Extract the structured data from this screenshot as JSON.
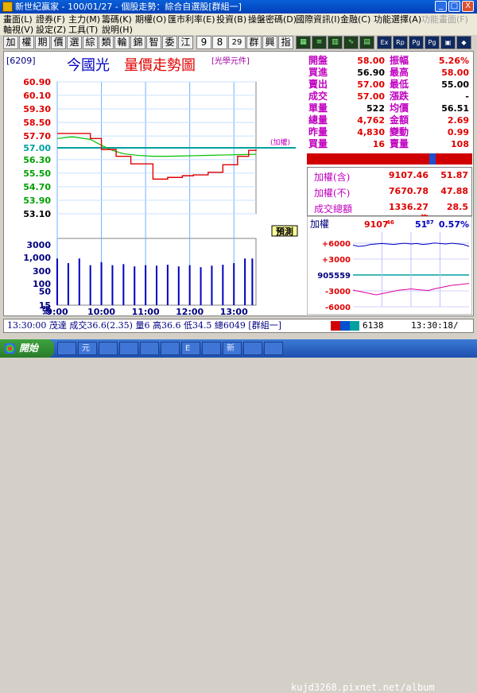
{
  "window": {
    "title": "新世紀贏家 - 100/01/27 - 個股走勢：綜合自選股[群組一]",
    "minimize_label": "_",
    "restore_label": "□",
    "close_label": "X"
  },
  "menu": {
    "row1": [
      {
        "label": "畫面(L)",
        "disabled": false
      },
      {
        "label": "證券(F)",
        "disabled": false
      },
      {
        "label": "主力(M)",
        "disabled": false
      },
      {
        "label": "籌碼(K)",
        "disabled": false
      },
      {
        "label": "期權(O)",
        "disabled": false
      },
      {
        "label": "匯市利率(E)",
        "disabled": false
      },
      {
        "label": "投資(B)",
        "disabled": false
      },
      {
        "label": "操盤密碼(D)",
        "disabled": false
      },
      {
        "label": "國際資訊(I)",
        "disabled": false
      },
      {
        "label": "金融(C)",
        "disabled": false
      },
      {
        "label": "功能選擇(A)",
        "disabled": false
      },
      {
        "label": "功能畫面(F)",
        "disabled": true
      }
    ],
    "row2": [
      {
        "label": "軸視(V)",
        "disabled": false
      },
      {
        "label": "設定(Z)",
        "disabled": false
      },
      {
        "label": "工具(T)",
        "disabled": false
      },
      {
        "label": "說明(H)",
        "disabled": false
      }
    ]
  },
  "toolbar": {
    "buttons": [
      "加",
      "權",
      "期",
      "價",
      "選",
      "綜",
      "類",
      "輪",
      "錦",
      "智",
      "委",
      "江",
      "9",
      "8",
      "29",
      "群",
      "興",
      "指"
    ],
    "icon_buttons": [
      "green-grid",
      "green-lines",
      "green-bars",
      "green-wave",
      "green-doc",
      "Ex",
      "Rp",
      "Page",
      "Page",
      "blue-box",
      "blue-arrow"
    ]
  },
  "stock": {
    "code": "[6209]",
    "name": "今國光",
    "chart_title": "量價走勢圖",
    "unit": "[光學元件]",
    "ref_tag": "(加權)",
    "forecast_tag": "預測"
  },
  "colors": {
    "price_line": "#e00000",
    "avg_line": "#00c000",
    "volume_bar": "#0000c0",
    "ref_line": "#00a0a0",
    "label_purple": "#c000c0",
    "up": "#e00000",
    "down": "#00a000"
  },
  "chart_data": {
    "type": "line",
    "title": "量價走勢圖",
    "y_ticks": [
      "60.90",
      "60.10",
      "59.30",
      "58.50",
      "57.70",
      "57.00",
      "56.30",
      "55.50",
      "54.70",
      "53.90",
      "53.10"
    ],
    "y_tick_colors": [
      "up",
      "up",
      "up",
      "up",
      "up",
      "ref",
      "down",
      "down",
      "down",
      "down",
      "plain"
    ],
    "ylim": [
      53.1,
      60.9
    ],
    "ref_price": 57.0,
    "vol_ticks": [
      "3000",
      "1,000",
      "300",
      "100",
      "50",
      "15",
      "張"
    ],
    "x_ticks": [
      "9:00",
      "10:00",
      "11:00",
      "12:00",
      "13:00"
    ],
    "x_range": [
      0,
      270
    ],
    "price_series": {
      "name": "",
      "x": [
        0,
        25,
        45,
        60,
        80,
        100,
        130,
        150,
        170,
        185,
        205,
        225,
        245,
        260,
        270
      ],
      "y": [
        57.85,
        57.85,
        57.55,
        56.9,
        56.5,
        56.05,
        55.15,
        55.25,
        55.35,
        55.4,
        55.55,
        56.0,
        56.5,
        56.85,
        56.9
      ]
    },
    "avg_series": {
      "name": "",
      "x": [
        0,
        20,
        45,
        60,
        75,
        90,
        110,
        130,
        150,
        170,
        190,
        210,
        230,
        250,
        270
      ],
      "y": [
        57.55,
        57.65,
        57.5,
        57.15,
        56.85,
        56.65,
        56.55,
        56.5,
        56.5,
        56.52,
        56.54,
        56.56,
        56.58,
        56.6,
        56.62
      ]
    },
    "volume": {
      "x": [
        0,
        15,
        30,
        45,
        60,
        75,
        90,
        105,
        120,
        135,
        150,
        165,
        180,
        195,
        210,
        225,
        240,
        255,
        265
      ],
      "values": [
        900,
        600,
        900,
        500,
        650,
        500,
        550,
        450,
        500,
        480,
        520,
        450,
        500,
        420,
        480,
        520,
        600,
        900,
        900
      ]
    }
  },
  "quotes": [
    {
      "l1": "開盤",
      "v1": "58.00",
      "c1": "up",
      "l2": "振幅",
      "v2": "5.26%",
      "c2": "up"
    },
    {
      "l1": "買進",
      "v1": "56.90",
      "c1": "plain",
      "l2": "最高",
      "v2": "58.00",
      "c2": "up"
    },
    {
      "l1": "賣出",
      "v1": "57.00",
      "c1": "up",
      "l2": "最低",
      "v2": "55.00",
      "c2": "plain"
    },
    {
      "l1": "成交",
      "v1": "57.00",
      "c1": "up",
      "l2": "漲跌",
      "v2": "-",
      "c2": "plain"
    },
    {
      "l1": "單量",
      "v1": "522",
      "c1": "plain",
      "l2": "均價",
      "v2": "56.51",
      "c2": "plain"
    },
    {
      "l1": "總量",
      "v1": "4,762",
      "c1": "up",
      "l2": "金額",
      "v2": "2.69",
      "c2": "up"
    },
    {
      "l1": "昨量",
      "v1": "4,830",
      "c1": "up",
      "l2": "變動",
      "v2": "0.99",
      "c2": "up"
    },
    {
      "l1": "買量",
      "v1": "16",
      "c1": "up",
      "l2": "賣量",
      "v2": "108",
      "c2": "up"
    }
  ],
  "index_box": [
    {
      "label": "加權(含)",
      "value": "9107.46",
      "extra": "51.87"
    },
    {
      "label": "加權(不)",
      "value": "7670.78",
      "extra": "47.88"
    },
    {
      "label": "成交總額",
      "value": "1336.27億",
      "extra": "28.5"
    }
  ],
  "mini_chart": {
    "label": "加權",
    "value": "9107",
    "value_sup": "46",
    "change": "51",
    "change_sup": "87",
    "pct": "0.57%",
    "y_ticks": [
      "+6000",
      "+3000",
      "905559",
      "-3000",
      "-6000"
    ],
    "index_line": [
      0.55,
      0.6,
      0.58,
      0.52,
      0.5,
      0.48,
      0.5,
      0.52,
      0.49,
      0.47,
      0.5,
      0.48,
      0.52,
      0.5,
      0.46,
      0.48,
      0.5,
      0.47,
      0.49,
      0.52,
      0.6
    ],
    "lower_line": [
      0.5,
      0.45,
      0.4,
      0.35,
      0.3,
      0.35,
      0.4,
      0.45,
      0.5,
      0.52,
      0.55,
      0.52,
      0.5,
      0.48,
      0.55,
      0.6,
      0.65,
      0.7,
      0.72,
      0.75,
      0.78
    ]
  },
  "status": {
    "text": "13:30:00 茂達 成交36.6(2.35) 量6 高36.6 低34.5 總6049 [群組一]",
    "code": "6138",
    "time": "13:30:18/"
  },
  "taskbar": {
    "start": "開始",
    "items": [
      "",
      "元",
      "",
      "",
      "",
      "",
      "E",
      "",
      "新",
      "",
      "",
      ""
    ],
    "watermark": "kujd3268.pixnet.net/album"
  }
}
